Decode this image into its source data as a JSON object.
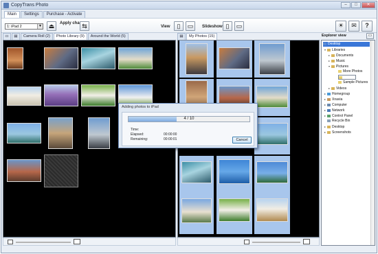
{
  "window": {
    "title": "CopyTrans Photo",
    "min": "–",
    "max": "□",
    "close": "✕"
  },
  "menu_tabs": [
    "Main",
    "Settings",
    "Purchase - Activate"
  ],
  "toolbar": {
    "device": "1: iPad 2",
    "apply_label": "Apply changes",
    "view_label": "View",
    "slideshow_label": "Slideshow",
    "bulb_icon": "bulb-icon",
    "mail_icon": "mail-icon",
    "help_label": "?"
  },
  "left_tabs": {
    "camera_roll": "Camera Roll (2)",
    "photo_library": "Photo Library (9)",
    "around_world": "Around the World (5)"
  },
  "right_tabs": {
    "my_photos": "My Photos (15)"
  },
  "explorer": {
    "header": "Explorer view",
    "items": [
      "Desktop",
      "Libraries",
      "Documents",
      "Music",
      "Pictures",
      "More Photos",
      "",
      "Sample Pictures",
      "Videos",
      "Homegroup",
      "Xnavia",
      "Computer",
      "Network",
      "Control Panel",
      "Recycle Bin",
      "Desktop",
      "Screenshots"
    ]
  },
  "dialog": {
    "title": "Adding photos to iPad",
    "progress_text": "4 / 10",
    "progress": 0.4,
    "time_label": "Time:",
    "elapsed_label": "Elapsed:",
    "elapsed_value": "00:00:00",
    "remaining_label": "Remaining:",
    "remaining_value": "00:00:01",
    "cancel": "Cancel"
  },
  "colors": {
    "accent": "#3a77d8",
    "selection": "#a8c6ec",
    "panel_bg": "#000000"
  }
}
